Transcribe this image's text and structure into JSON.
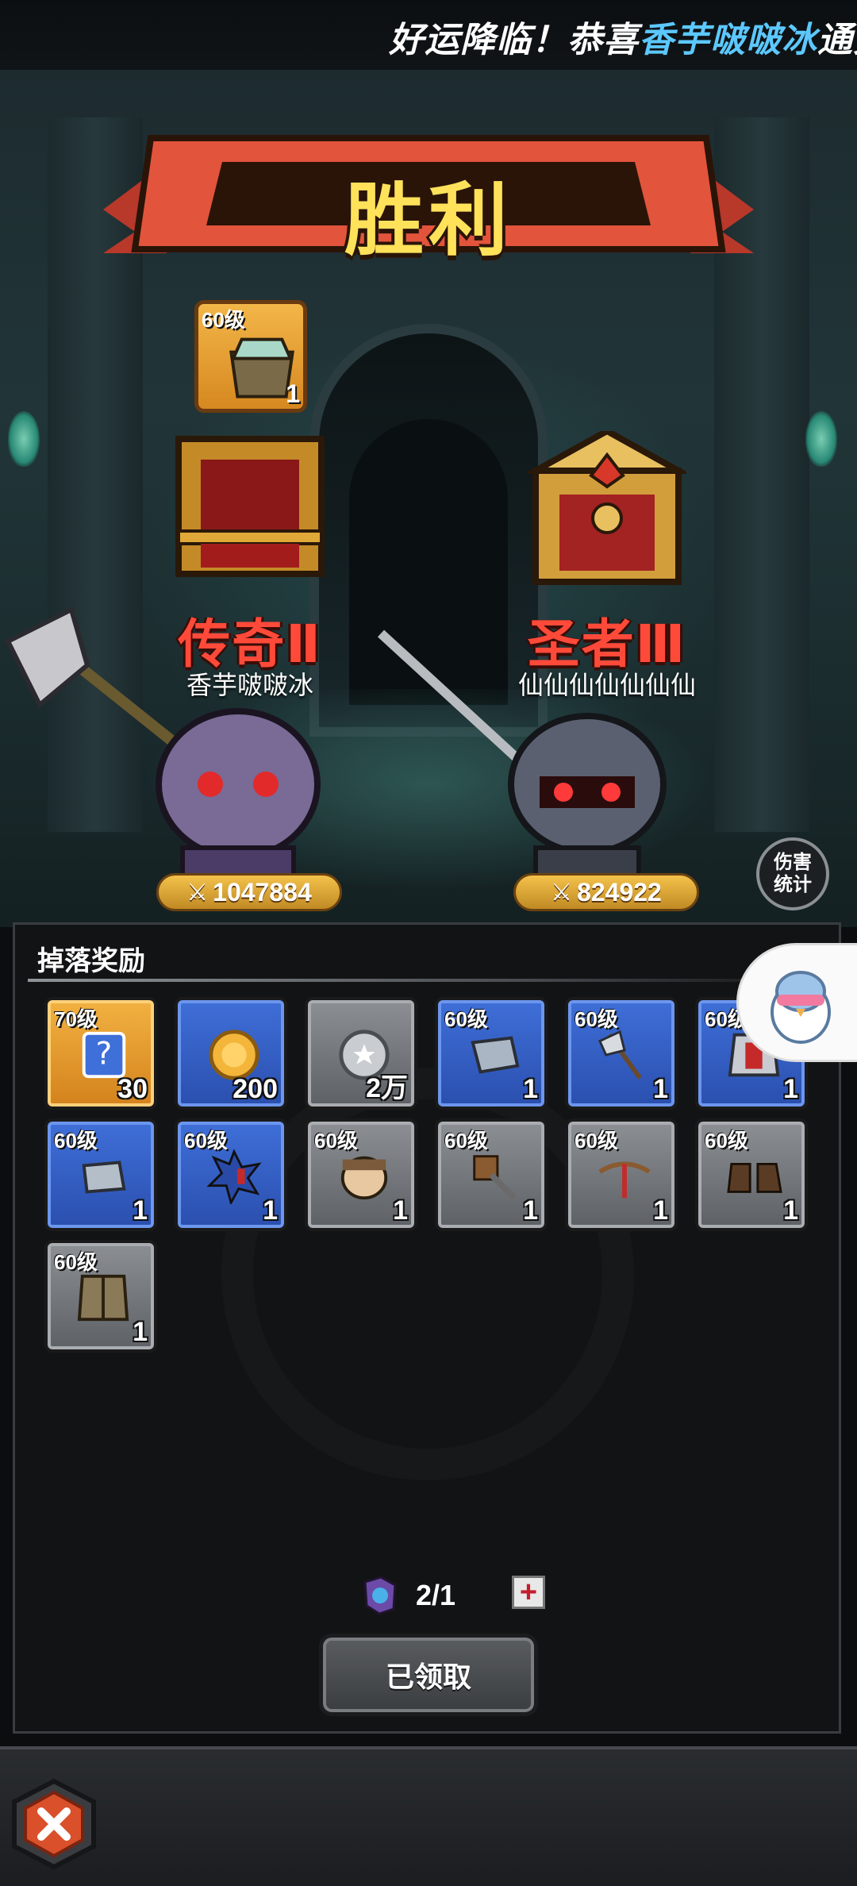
{
  "marquee": {
    "prefix": "好运降临！恭喜",
    "highlight_name": "香芋啵啵冰",
    "suffix": "通关",
    "highlight_color": "#5cc8ff"
  },
  "banner": {
    "title": "胜利"
  },
  "scene_drop": {
    "level": "60级",
    "qty": "1",
    "icon": "armor-icon"
  },
  "players": {
    "left": {
      "rank": "传奇Ⅱ",
      "name": "香芋啵啵冰",
      "power": "1047884",
      "chest": "open-chest-icon"
    },
    "right": {
      "rank": "圣者Ⅲ",
      "name": "仙仙仙仙仙仙仙",
      "power": "824922",
      "chest": "locked-chest-icon"
    }
  },
  "damage_stats": {
    "line1": "伤害",
    "line2": "统计"
  },
  "rewards_panel": {
    "title": "掉落奖励",
    "items": [
      {
        "name": "puzzle-fragment",
        "level": "70级",
        "qty": "30",
        "rarity": "gold",
        "icon": "puzzle-icon"
      },
      {
        "name": "gold-coin",
        "level": "",
        "qty": "200",
        "rarity": "blue",
        "icon": "gold-coin-icon"
      },
      {
        "name": "silver-coin",
        "level": "",
        "qty": "2万",
        "rarity": "gray",
        "icon": "silver-coin-icon"
      },
      {
        "name": "shoulder-armor",
        "level": "60级",
        "qty": "1",
        "rarity": "blue",
        "icon": "shoulder-armor-icon"
      },
      {
        "name": "battle-axe",
        "level": "60级",
        "qty": "1",
        "rarity": "blue",
        "icon": "axe-icon"
      },
      {
        "name": "chest-armor",
        "level": "60级",
        "qty": "1",
        "rarity": "blue",
        "icon": "chest-armor-icon"
      },
      {
        "name": "gauntlet",
        "level": "60级",
        "qty": "1",
        "rarity": "blue",
        "icon": "gauntlet-icon"
      },
      {
        "name": "spiked-orb",
        "level": "60级",
        "qty": "1",
        "rarity": "blue",
        "icon": "spiked-orb-icon"
      },
      {
        "name": "helmet-face",
        "level": "60级",
        "qty": "1",
        "rarity": "gray",
        "icon": "helmet-icon"
      },
      {
        "name": "hammer",
        "level": "60级",
        "qty": "1",
        "rarity": "gray",
        "icon": "hammer-icon"
      },
      {
        "name": "crossbow",
        "level": "60级",
        "qty": "1",
        "rarity": "gray",
        "icon": "crossbow-icon"
      },
      {
        "name": "boots",
        "level": "60级",
        "qty": "1",
        "rarity": "gray",
        "icon": "boots-icon"
      },
      {
        "name": "leather-armor",
        "level": "60级",
        "qty": "1",
        "rarity": "gray",
        "icon": "leather-armor-icon"
      }
    ]
  },
  "counter": {
    "text": "2/1",
    "icon": "hero-token-icon",
    "plus": "+"
  },
  "claim_button": {
    "label": "已领取"
  },
  "close_button": {
    "icon": "close-icon"
  }
}
